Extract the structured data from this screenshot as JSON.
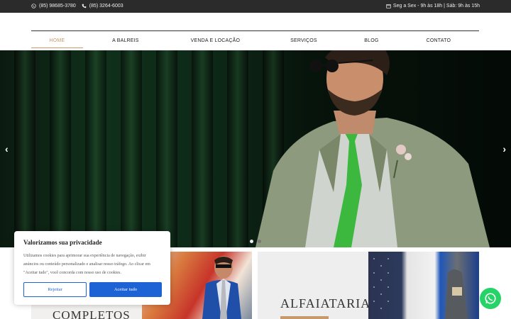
{
  "topbar": {
    "phone1": "(85) 98685-3780",
    "phone2": "(85) 3264-6003",
    "hours": "Seg a Sex - 9h às 18h | Sáb: 9h às 15h"
  },
  "nav": {
    "items": [
      "HOME",
      "A BALREIS",
      "VENDA E LOCAÇÃO",
      "SERVIÇOS",
      "BLOG",
      "CONTATO"
    ],
    "active": "HOME"
  },
  "slider": {
    "prev": "‹",
    "next": "›",
    "slide_count": 2,
    "active_slide": 1
  },
  "cards": [
    {
      "title": "COMPLETOS"
    },
    {
      "title": "ALFAIATARIA"
    }
  ],
  "cookie": {
    "title": "Valorizamos sua privacidade",
    "text": "Utilizamos cookies para aprimorar sua experiência de navegação, exibir anúncios ou conteúdo personalizado e analisar nosso tráfego. Ao clicar em \"Aceitar tudo\", você concorda com nosso uso de cookies.",
    "reject": "Rejeitar",
    "accept": "Aceitar tudo"
  },
  "colors": {
    "accent": "#c89a6b",
    "topbar": "#2b2b2b",
    "cookie_button": "#1e63d6",
    "whatsapp": "#25d366"
  }
}
